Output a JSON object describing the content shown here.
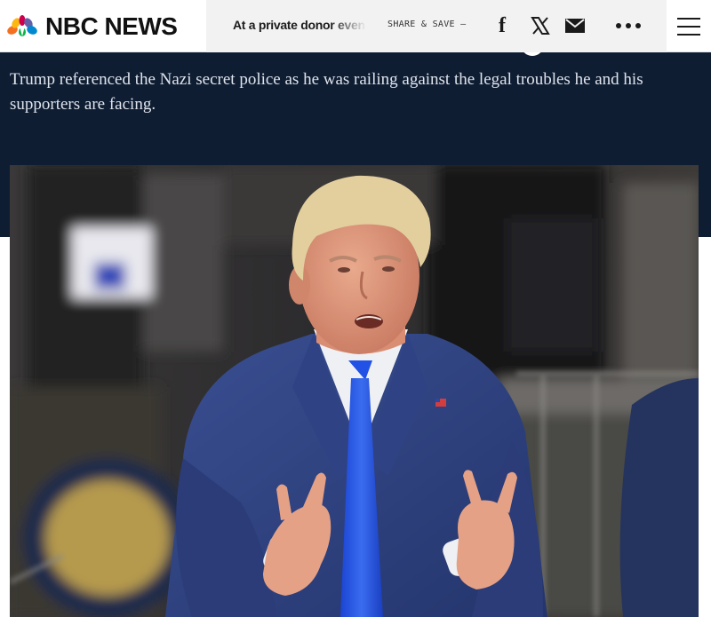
{
  "header": {
    "brand": "NBC NEWS",
    "ticker_text": "At a private donor even",
    "share_label": "SHARE & SAVE —"
  },
  "icons": {
    "logo": "nbc-peacock-icon",
    "facebook": "facebook-icon",
    "x": "x-icon",
    "email": "mail-icon",
    "more": "more-icon",
    "menu": "hamburger-menu-icon"
  },
  "article": {
    "dek": "Trump referenced the Nazi secret police as he was railing against the legal troubles he and his supporters are facing."
  },
  "colors": {
    "band": "#0f1d33",
    "tie": "#1f4fe0",
    "suit": "#2c3d7a"
  }
}
